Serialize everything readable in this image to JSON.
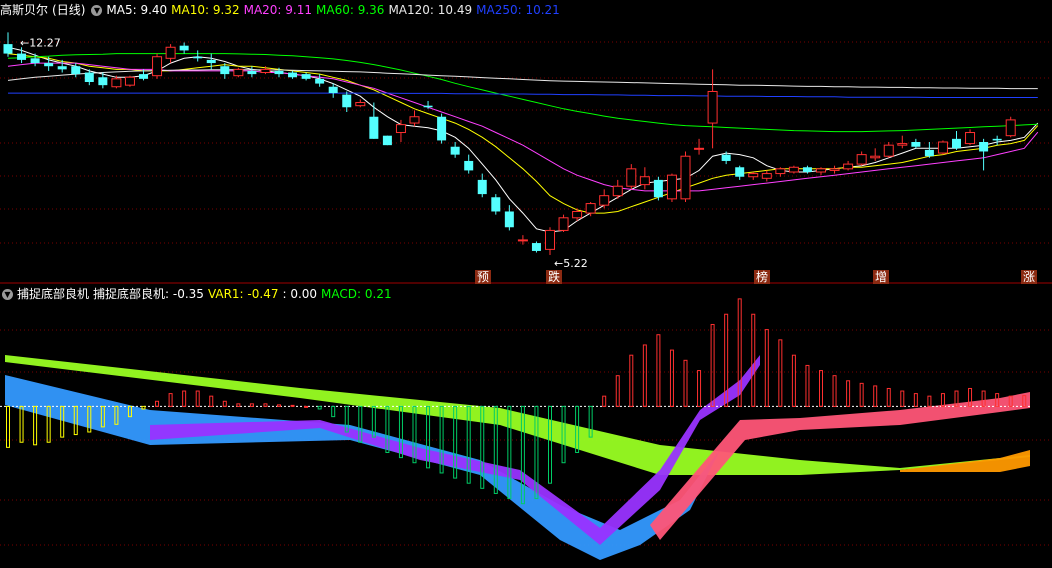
{
  "stock": {
    "name": "高斯贝尔",
    "period": "(日线)"
  },
  "ma_legend": [
    {
      "label": "MA5: 9.40",
      "color": "#ffffff"
    },
    {
      "label": "MA10: 9.32",
      "color": "#ffff00"
    },
    {
      "label": "MA20: 9.11",
      "color": "#ff40ff"
    },
    {
      "label": "MA60: 9.36",
      "color": "#00ff00"
    },
    {
      "label": "MA120: 10.49",
      "color": "#e8e8e8"
    },
    {
      "label": "MA250: 10.21",
      "color": "#2040ff"
    }
  ],
  "price": {
    "high_label": "12.27",
    "low_label": "5.22"
  },
  "events": [
    "预",
    "跌",
    "榜",
    "增",
    "涨"
  ],
  "indicator": {
    "name": "捕捉底部良机",
    "values": [
      {
        "label": "捕捉底部良机: -0.35",
        "color": "#ffffff"
      },
      {
        "label": "VAR1: -0.47",
        "color": "#ffff00"
      },
      {
        "label": ": 0.00",
        "color": "#ffffff"
      },
      {
        "label": "MACD: 0.21",
        "color": "#00ff00"
      }
    ]
  },
  "colors": {
    "up": "#ff3030",
    "down": "#54ffff",
    "grid": "#7a0000"
  },
  "chart_data": {
    "type": "candlestick",
    "candles": [
      {
        "o": 11.9,
        "h": 12.27,
        "l": 11.5,
        "c": 11.6
      },
      {
        "o": 11.6,
        "h": 11.8,
        "l": 11.3,
        "c": 11.4
      },
      {
        "o": 11.45,
        "h": 11.6,
        "l": 11.2,
        "c": 11.3
      },
      {
        "o": 11.3,
        "h": 11.5,
        "l": 11.05,
        "c": 11.2
      },
      {
        "o": 11.2,
        "h": 11.4,
        "l": 11.0,
        "c": 11.1
      },
      {
        "o": 11.2,
        "h": 11.3,
        "l": 10.85,
        "c": 10.95
      },
      {
        "o": 11.0,
        "h": 11.1,
        "l": 10.6,
        "c": 10.7
      },
      {
        "o": 10.85,
        "h": 11.0,
        "l": 10.5,
        "c": 10.6
      },
      {
        "o": 10.55,
        "h": 10.9,
        "l": 10.5,
        "c": 10.8
      },
      {
        "o": 10.6,
        "h": 10.9,
        "l": 10.55,
        "c": 10.85
      },
      {
        "o": 10.95,
        "h": 11.1,
        "l": 10.75,
        "c": 10.8
      },
      {
        "o": 10.9,
        "h": 11.6,
        "l": 10.8,
        "c": 11.5
      },
      {
        "o": 11.45,
        "h": 11.9,
        "l": 11.3,
        "c": 11.8
      },
      {
        "o": 11.85,
        "h": 11.95,
        "l": 11.6,
        "c": 11.7
      },
      {
        "o": 11.5,
        "h": 11.7,
        "l": 11.35,
        "c": 11.45
      },
      {
        "o": 11.4,
        "h": 11.6,
        "l": 11.1,
        "c": 11.3
      },
      {
        "o": 11.2,
        "h": 11.3,
        "l": 10.8,
        "c": 10.95
      },
      {
        "o": 10.9,
        "h": 11.15,
        "l": 10.85,
        "c": 11.1
      },
      {
        "o": 11.05,
        "h": 11.2,
        "l": 10.85,
        "c": 10.95
      },
      {
        "o": 11.0,
        "h": 11.2,
        "l": 10.95,
        "c": 11.1
      },
      {
        "o": 11.05,
        "h": 11.15,
        "l": 10.85,
        "c": 10.95
      },
      {
        "o": 11.0,
        "h": 11.05,
        "l": 10.8,
        "c": 10.85
      },
      {
        "o": 10.95,
        "h": 11.0,
        "l": 10.75,
        "c": 10.8
      },
      {
        "o": 10.8,
        "h": 10.95,
        "l": 10.55,
        "c": 10.65
      },
      {
        "o": 10.55,
        "h": 10.65,
        "l": 10.2,
        "c": 10.35
      },
      {
        "o": 10.3,
        "h": 10.4,
        "l": 9.75,
        "c": 9.9
      },
      {
        "o": 9.95,
        "h": 10.15,
        "l": 9.9,
        "c": 10.05
      },
      {
        "o": 9.6,
        "h": 10.05,
        "l": 8.9,
        "c": 8.9
      },
      {
        "o": 9.0,
        "h": 9.0,
        "l": 8.7,
        "c": 8.7
      },
      {
        "o": 9.1,
        "h": 9.5,
        "l": 8.8,
        "c": 9.35
      },
      {
        "o": 9.4,
        "h": 9.8,
        "l": 9.3,
        "c": 9.6
      },
      {
        "o": 9.95,
        "h": 10.1,
        "l": 9.85,
        "c": 9.9
      },
      {
        "o": 9.6,
        "h": 9.7,
        "l": 8.75,
        "c": 8.85
      },
      {
        "o": 8.65,
        "h": 8.8,
        "l": 8.3,
        "c": 8.4
      },
      {
        "o": 8.2,
        "h": 8.4,
        "l": 7.8,
        "c": 7.9
      },
      {
        "o": 7.6,
        "h": 7.8,
        "l": 7.05,
        "c": 7.15
      },
      {
        "o": 7.05,
        "h": 7.15,
        "l": 6.5,
        "c": 6.6
      },
      {
        "o": 6.6,
        "h": 6.8,
        "l": 6.0,
        "c": 6.1
      },
      {
        "o": 5.7,
        "h": 5.85,
        "l": 5.55,
        "c": 5.7
      },
      {
        "o": 5.6,
        "h": 5.65,
        "l": 5.3,
        "c": 5.35
      },
      {
        "o": 5.4,
        "h": 6.1,
        "l": 5.22,
        "c": 6.0
      },
      {
        "o": 6.0,
        "h": 6.5,
        "l": 5.95,
        "c": 6.4
      },
      {
        "o": 6.4,
        "h": 6.7,
        "l": 6.3,
        "c": 6.6
      },
      {
        "o": 6.55,
        "h": 6.9,
        "l": 6.45,
        "c": 6.85
      },
      {
        "o": 6.8,
        "h": 7.3,
        "l": 6.7,
        "c": 7.1
      },
      {
        "o": 7.1,
        "h": 7.6,
        "l": 7.0,
        "c": 7.4
      },
      {
        "o": 7.4,
        "h": 8.1,
        "l": 7.3,
        "c": 7.95
      },
      {
        "o": 7.45,
        "h": 8.0,
        "l": 7.3,
        "c": 7.7
      },
      {
        "o": 7.6,
        "h": 7.7,
        "l": 6.95,
        "c": 7.05
      },
      {
        "o": 7.0,
        "h": 7.8,
        "l": 6.9,
        "c": 7.75
      },
      {
        "o": 7.0,
        "h": 8.5,
        "l": 6.9,
        "c": 8.35
      },
      {
        "o": 8.6,
        "h": 8.9,
        "l": 8.4,
        "c": 8.6
      },
      {
        "o": 9.4,
        "h": 11.1,
        "l": 8.6,
        "c": 10.4
      },
      {
        "o": 8.4,
        "h": 8.5,
        "l": 8.1,
        "c": 8.2
      },
      {
        "o": 8.0,
        "h": 8.05,
        "l": 7.6,
        "c": 7.7
      },
      {
        "o": 7.7,
        "h": 7.85,
        "l": 7.6,
        "c": 7.8
      },
      {
        "o": 7.65,
        "h": 7.9,
        "l": 7.55,
        "c": 7.8
      },
      {
        "o": 7.8,
        "h": 8.0,
        "l": 7.7,
        "c": 7.95
      },
      {
        "o": 7.85,
        "h": 8.05,
        "l": 7.8,
        "c": 8.0
      },
      {
        "o": 8.0,
        "h": 8.05,
        "l": 7.8,
        "c": 7.85
      },
      {
        "o": 7.85,
        "h": 8.0,
        "l": 7.75,
        "c": 7.95
      },
      {
        "o": 7.9,
        "h": 8.05,
        "l": 7.8,
        "c": 7.95
      },
      {
        "o": 7.95,
        "h": 8.2,
        "l": 7.9,
        "c": 8.1
      },
      {
        "o": 8.1,
        "h": 8.5,
        "l": 8.05,
        "c": 8.4
      },
      {
        "o": 8.3,
        "h": 8.6,
        "l": 8.2,
        "c": 8.35
      },
      {
        "o": 8.35,
        "h": 8.8,
        "l": 8.3,
        "c": 8.7
      },
      {
        "o": 8.7,
        "h": 9.0,
        "l": 8.6,
        "c": 8.75
      },
      {
        "o": 8.8,
        "h": 8.9,
        "l": 8.6,
        "c": 8.65
      },
      {
        "o": 8.55,
        "h": 8.8,
        "l": 8.3,
        "c": 8.35
      },
      {
        "o": 8.45,
        "h": 8.85,
        "l": 8.4,
        "c": 8.8
      },
      {
        "o": 8.9,
        "h": 9.15,
        "l": 8.55,
        "c": 8.6
      },
      {
        "o": 8.75,
        "h": 9.2,
        "l": 8.7,
        "c": 9.1
      },
      {
        "o": 8.8,
        "h": 8.9,
        "l": 7.9,
        "c": 8.5
      },
      {
        "o": 8.9,
        "h": 9.0,
        "l": 8.7,
        "c": 8.85
      },
      {
        "o": 9.0,
        "h": 9.6,
        "l": 8.95,
        "c": 9.5
      }
    ],
    "ma": {
      "MA5": [
        11.8,
        11.7,
        11.55,
        11.4,
        11.3,
        11.2,
        11.05,
        10.95,
        10.85,
        10.85,
        10.9,
        11.05,
        11.3,
        11.45,
        11.5,
        11.45,
        11.35,
        11.2,
        11.1,
        11.05,
        11.0,
        10.95,
        10.9,
        10.8,
        10.65,
        10.45,
        10.25,
        9.9,
        9.6,
        9.35,
        9.3,
        9.25,
        9.15,
        8.95,
        8.6,
        8.1,
        7.6,
        7.0,
        6.55,
        6.05,
        5.95,
        6.0,
        6.3,
        6.55,
        6.8,
        7.05,
        7.3,
        7.5,
        7.55,
        7.6,
        7.65,
        7.9,
        8.35,
        8.45,
        8.4,
        8.3,
        8.05,
        7.9,
        7.85,
        7.85,
        7.9,
        7.95,
        8.0,
        8.05,
        8.15,
        8.3,
        8.45,
        8.6,
        8.6,
        8.6,
        8.6,
        8.65,
        8.7,
        8.8,
        8.85,
        8.95,
        9.4
      ],
      "MA10": [
        11.6,
        11.55,
        11.5,
        11.45,
        11.35,
        11.3,
        11.2,
        11.15,
        11.1,
        11.1,
        11.05,
        11.05,
        11.05,
        11.1,
        11.15,
        11.2,
        11.25,
        11.2,
        11.2,
        11.15,
        11.1,
        11.05,
        11.0,
        10.95,
        10.85,
        10.75,
        10.6,
        10.45,
        10.25,
        10.05,
        9.85,
        9.7,
        9.55,
        9.4,
        9.2,
        8.95,
        8.65,
        8.3,
        7.95,
        7.55,
        7.1,
        6.85,
        6.65,
        6.55,
        6.55,
        6.6,
        6.75,
        6.9,
        7.05,
        7.2,
        7.35,
        7.5,
        7.65,
        7.75,
        7.8,
        7.85,
        7.9,
        7.95,
        7.95,
        7.95,
        7.95,
        7.95,
        8.0,
        8.0,
        8.05,
        8.1,
        8.15,
        8.25,
        8.35,
        8.4,
        8.5,
        8.55,
        8.6,
        8.7,
        8.75,
        8.85,
        9.32
      ],
      "MA20": [
        11.2,
        11.25,
        11.3,
        11.3,
        11.3,
        11.3,
        11.25,
        11.2,
        11.15,
        11.1,
        11.1,
        11.1,
        11.05,
        11.05,
        11.05,
        11.05,
        11.05,
        11.05,
        11.05,
        11.0,
        11.0,
        10.95,
        10.9,
        10.85,
        10.8,
        10.7,
        10.6,
        10.5,
        10.35,
        10.2,
        10.05,
        9.9,
        9.75,
        9.6,
        9.45,
        9.3,
        9.1,
        8.9,
        8.7,
        8.45,
        8.2,
        7.95,
        7.75,
        7.6,
        7.45,
        7.35,
        7.3,
        7.25,
        7.25,
        7.25,
        7.25,
        7.25,
        7.3,
        7.35,
        7.4,
        7.45,
        7.5,
        7.55,
        7.6,
        7.65,
        7.7,
        7.75,
        7.8,
        7.85,
        7.9,
        7.95,
        8.0,
        8.05,
        8.1,
        8.15,
        8.2,
        8.25,
        8.3,
        8.4,
        8.5,
        8.6,
        9.11
      ],
      "MA60": [
        11.45,
        11.47,
        11.5,
        11.52,
        11.55,
        11.56,
        11.57,
        11.58,
        11.6,
        11.6,
        11.6,
        11.6,
        11.6,
        11.6,
        11.6,
        11.6,
        11.6,
        11.59,
        11.58,
        11.57,
        11.55,
        11.53,
        11.5,
        11.47,
        11.43,
        11.38,
        11.32,
        11.25,
        11.17,
        11.08,
        10.98,
        10.88,
        10.78,
        10.66,
        10.55,
        10.45,
        10.35,
        10.25,
        10.15,
        10.05,
        9.95,
        9.85,
        9.77,
        9.7,
        9.62,
        9.55,
        9.5,
        9.45,
        9.4,
        9.35,
        9.32,
        9.3,
        9.28,
        9.26,
        9.24,
        9.22,
        9.2,
        9.18,
        9.16,
        9.15,
        9.14,
        9.13,
        9.13,
        9.13,
        9.14,
        9.15,
        9.16,
        9.18,
        9.2,
        9.22,
        9.24,
        9.26,
        9.28,
        9.3,
        9.32,
        9.34,
        9.36
      ],
      "MA120": [
        10.75,
        10.8,
        10.85,
        10.88,
        10.92,
        10.95,
        10.98,
        11.0,
        11.02,
        11.04,
        11.05,
        11.06,
        11.07,
        11.08,
        11.08,
        11.09,
        11.09,
        11.09,
        11.09,
        11.08,
        11.08,
        11.07,
        11.06,
        11.05,
        11.04,
        11.03,
        11.02,
        11.0,
        10.98,
        10.96,
        10.94,
        10.92,
        10.9,
        10.88,
        10.86,
        10.84,
        10.82,
        10.8,
        10.78,
        10.76,
        10.74,
        10.73,
        10.72,
        10.71,
        10.7,
        10.69,
        10.68,
        10.67,
        10.66,
        10.65,
        10.64,
        10.63,
        10.62,
        10.61,
        10.6,
        10.6,
        10.59,
        10.58,
        10.57,
        10.56,
        10.56,
        10.55,
        10.55,
        10.54,
        10.54,
        10.53,
        10.53,
        10.52,
        10.52,
        10.51,
        10.51,
        10.5,
        10.5,
        10.5,
        10.49,
        10.49,
        10.49
      ],
      "MA250": [
        10.35,
        10.35,
        10.35,
        10.35,
        10.35,
        10.35,
        10.35,
        10.35,
        10.35,
        10.35,
        10.35,
        10.35,
        10.35,
        10.35,
        10.35,
        10.35,
        10.35,
        10.35,
        10.35,
        10.35,
        10.35,
        10.35,
        10.35,
        10.35,
        10.35,
        10.35,
        10.35,
        10.35,
        10.35,
        10.34,
        10.34,
        10.34,
        10.34,
        10.33,
        10.33,
        10.33,
        10.32,
        10.32,
        10.32,
        10.31,
        10.31,
        10.3,
        10.3,
        10.3,
        10.29,
        10.29,
        10.28,
        10.28,
        10.27,
        10.27,
        10.27,
        10.26,
        10.26,
        10.25,
        10.25,
        10.25,
        10.24,
        10.24,
        10.24,
        10.23,
        10.23,
        10.23,
        10.22,
        10.22,
        10.22,
        10.22,
        10.22,
        10.22,
        10.21,
        10.21,
        10.21,
        10.21,
        10.21,
        10.21,
        10.21,
        10.21,
        10.21
      ]
    },
    "y_range": [
      5.0,
      12.6
    ],
    "indicator_range": [
      -3.0,
      2.0
    ],
    "indicator_bars": [
      -0.8,
      -0.7,
      -0.75,
      -0.7,
      -0.6,
      -0.55,
      -0.5,
      -0.4,
      -0.35,
      -0.2,
      -0.05,
      0.1,
      0.25,
      0.3,
      0.3,
      0.2,
      0.1,
      0.05,
      0.05,
      0.05,
      0.03,
      0.02,
      0.0,
      -0.05,
      -0.2,
      -0.5,
      -0.7,
      -0.6,
      -0.9,
      -1.0,
      -1.1,
      -1.2,
      -1.3,
      -1.4,
      -1.5,
      -1.6,
      -1.7,
      -1.8,
      -1.9,
      -1.8,
      -1.5,
      -1.1,
      -0.9,
      -0.6,
      0.2,
      0.6,
      1.0,
      1.2,
      1.4,
      1.1,
      0.9,
      0.7,
      1.6,
      1.8,
      2.1,
      1.8,
      1.5,
      1.3,
      1.0,
      0.8,
      0.7,
      0.6,
      0.5,
      0.45,
      0.4,
      0.35,
      0.3,
      0.25,
      0.2,
      0.25,
      0.3,
      0.35,
      0.3,
      0.25,
      0.2,
      0.21
    ]
  }
}
